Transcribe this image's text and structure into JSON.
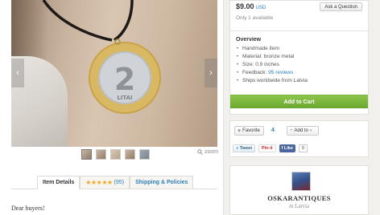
{
  "listing": {
    "zoom_label": "zoom",
    "nav_prev": "‹",
    "nav_next": "›",
    "thumbnails": [
      "thumb-1",
      "thumb-2",
      "thumb-3",
      "thumb-4",
      "thumb-5"
    ],
    "coin": {
      "numeral": "2",
      "legend": "LITAI"
    }
  },
  "tabs": {
    "item_details": "Item Details",
    "reviews_count": "(95)",
    "shipping": "Shipping & Policies"
  },
  "description": {
    "greeting": "Dear buyers!"
  },
  "purchase": {
    "price": "$9.00",
    "currency": "USD",
    "ask_button": "Ask a Question",
    "availability": "Only 1 available",
    "overview_title": "Overview",
    "overview_items": {
      "handmade": "Handmade item",
      "material": "Material: bronze metal",
      "size": "Size: 0.9 inches",
      "feedback_prefix": "Feedback: ",
      "feedback_link": "95 reviews",
      "ships": "Ships worldwide from Latvia"
    },
    "cart_button": "Add to Cart"
  },
  "social": {
    "favorite_label": "Favorite",
    "favorite_count": "4",
    "add_to_label": "Add to",
    "tweet_label": "Tweet",
    "pin_label": "Pin it",
    "like_label": "Like",
    "like_count": "0"
  },
  "shop": {
    "name": "OSKARANTIQUES",
    "location_prefix": "in",
    "location": "Latvia"
  },
  "colors": {
    "accent_link": "#2a7fb8",
    "cart_green": "#7ab83f",
    "star_orange": "#f2a51a",
    "facebook_blue": "#4a66a0"
  }
}
